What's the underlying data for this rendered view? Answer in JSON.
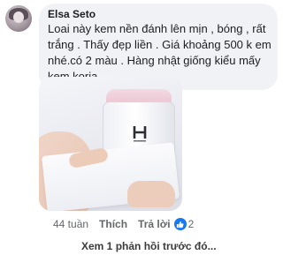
{
  "comment": {
    "author": "Elsa Seto",
    "text": "Loai này kem nền đánh lên mịn , bóng , rất trắng . Thấy đẹp liền . Giá khoảng 500 k em nhé.có 2 màu . Hàng nhật giống kiểu mấy kem koria"
  },
  "photo": {
    "subject": "cream-jar-photo"
  },
  "actions": {
    "time": "44 tuần",
    "like_label": "Thích",
    "reply_label": "Trả lời",
    "reaction_count": "2"
  },
  "previous_replies_link": "Xem 1 phản hồi trước đó...",
  "colors": {
    "bubble_bg": "#f0f2f5",
    "like_blue": "#1877f2",
    "meta_text": "#65676b"
  }
}
